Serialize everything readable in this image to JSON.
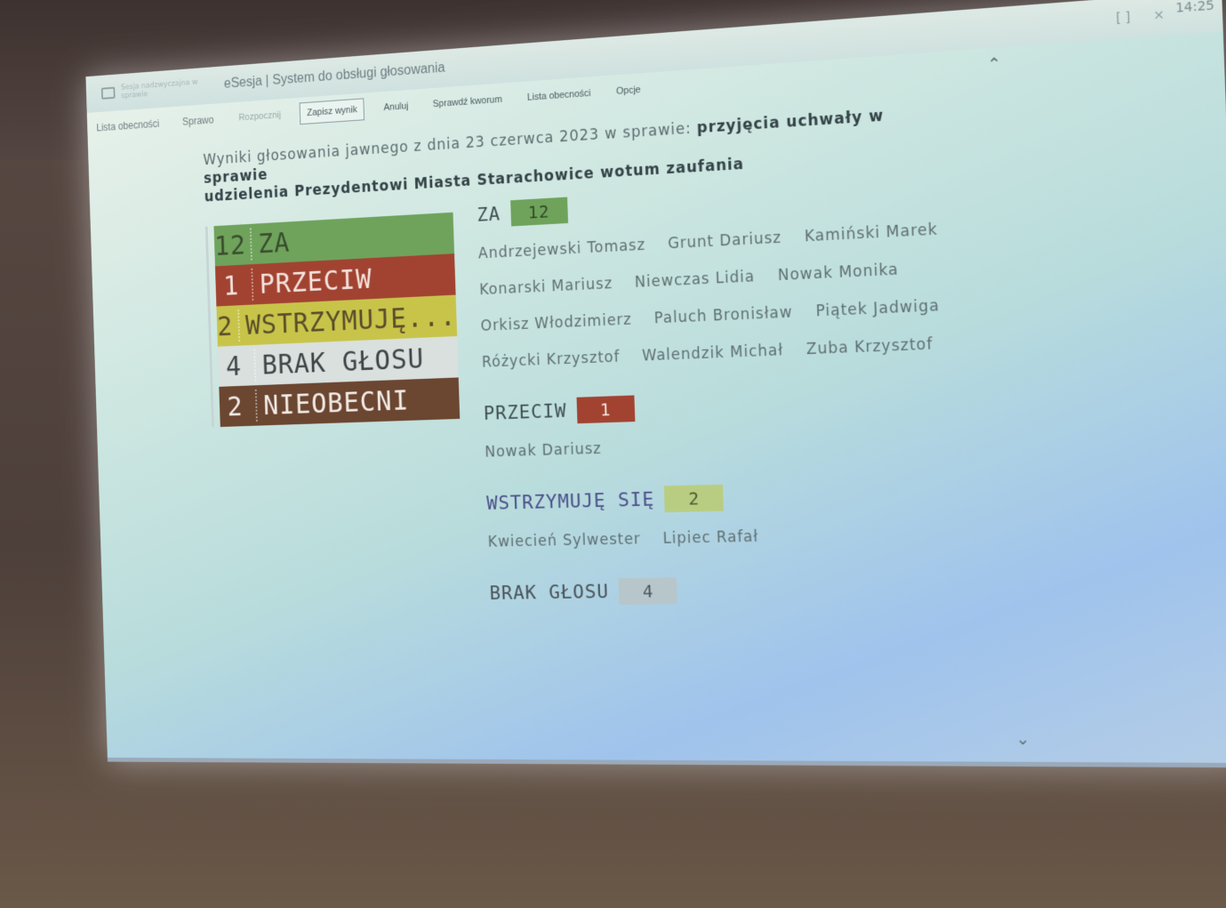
{
  "window": {
    "faded_title": "Sesja nadzwyczajna w sprawie",
    "title": "eSesja | System do obsługi głosowania",
    "restore_glyph": "[ ]",
    "close_glyph": "×",
    "time": "14:25"
  },
  "tabs": {
    "attendance": "Lista obecności",
    "report": "Sprawo"
  },
  "toolbar": {
    "start": "Rozpocznij",
    "save": "Zapisz wynik",
    "cancel": "Anuluj",
    "quorum": "Sprawdź kworum",
    "attendance": "Lista obecności",
    "options": "Opcje"
  },
  "header": {
    "prefix": "Wyniki głosowania jawnego z dnia 23 czerwca 2023 w sprawie:",
    "subject_line1": "przyjęcia uchwały w sprawie",
    "subject_line2": "udzielenia Prezydentowi Miasta Starachowice wotum zaufania"
  },
  "summary": [
    {
      "count": "12",
      "label": "ZA"
    },
    {
      "count": "1",
      "label": "PRZECIW"
    },
    {
      "count": "2",
      "label": "WSTRZYMUJĘ..."
    },
    {
      "count": "4",
      "label": "BRAK GŁOSU"
    },
    {
      "count": "2",
      "label": "NIEOBECNI"
    }
  ],
  "categories": {
    "za": {
      "label": "ZA",
      "count": "12",
      "names": [
        "Andrzejewski Tomasz",
        "Grunt Dariusz",
        "Kamiński Marek",
        "Konarski Mariusz",
        "Niewczas Lidia",
        "Nowak Monika",
        "Orkisz Włodzimierz",
        "Paluch Bronisław",
        "Piątek Jadwiga",
        "Różycki Krzysztof",
        "Walendzik Michał",
        "Zuba Krzysztof"
      ]
    },
    "przeciw": {
      "label": "PRZECIW",
      "count": "1",
      "names": [
        "Nowak Dariusz"
      ]
    },
    "wstrzymuje": {
      "label": "WSTRZYMUJĘ SIĘ",
      "count": "2",
      "names": [
        "Kwiecień Sylwester",
        "Lipiec Rafał"
      ]
    },
    "brak": {
      "label": "BRAK GŁOSU",
      "count": "4"
    }
  },
  "colors": {
    "za": "#6fa35c",
    "przeciw": "#a24332",
    "wstrzymuje": "#c8c44a",
    "brak": "#d9e0de",
    "nieobecni": "#6b4631"
  },
  "icons": {
    "collapse": "chevron-up-icon",
    "expand": "chevron-down-icon"
  }
}
